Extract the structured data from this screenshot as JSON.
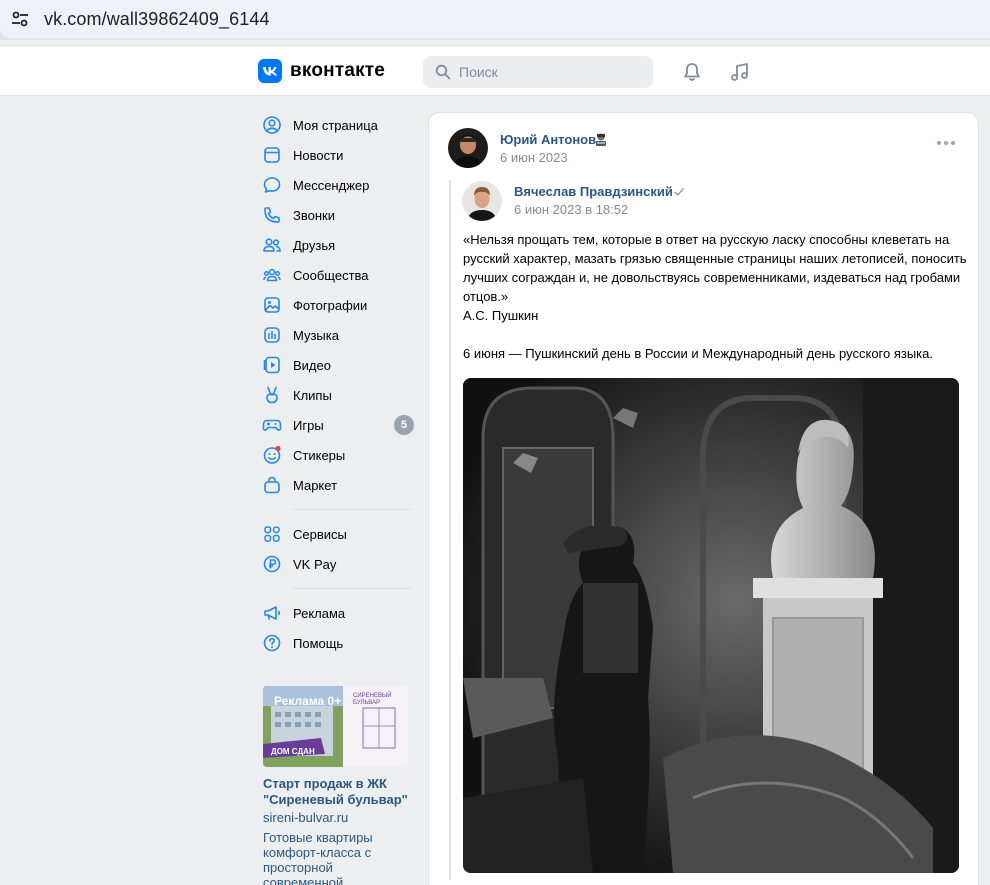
{
  "browser": {
    "url": "vk.com/wall39862409_6144"
  },
  "header": {
    "logo_text": "вконтакте",
    "logo_letter": "K",
    "search_placeholder": "Поиск",
    "brand_color": "#0077ff"
  },
  "nav": {
    "items": [
      {
        "label": "Моя страница",
        "icon": "profile-icon"
      },
      {
        "label": "Новости",
        "icon": "news-icon"
      },
      {
        "label": "Мессенджер",
        "icon": "messenger-icon"
      },
      {
        "label": "Звонки",
        "icon": "phone-icon"
      },
      {
        "label": "Друзья",
        "icon": "friends-icon"
      },
      {
        "label": "Сообщества",
        "icon": "communities-icon"
      },
      {
        "label": "Фотографии",
        "icon": "photos-icon"
      },
      {
        "label": "Музыка",
        "icon": "music-icon"
      },
      {
        "label": "Видео",
        "icon": "video-icon"
      },
      {
        "label": "Клипы",
        "icon": "clips-icon"
      },
      {
        "label": "Игры",
        "icon": "games-icon",
        "badge": "5"
      },
      {
        "label": "Стикеры",
        "icon": "stickers-icon"
      },
      {
        "label": "Маркет",
        "icon": "market-icon"
      }
    ],
    "extra": [
      {
        "label": "Сервисы",
        "icon": "services-icon"
      },
      {
        "label": "VK Pay",
        "icon": "vkpay-icon"
      }
    ],
    "bottom": [
      {
        "label": "Реклама",
        "icon": "ads-icon"
      },
      {
        "label": "Помощь",
        "icon": "help-icon"
      }
    ]
  },
  "ad": {
    "image_badge": "Реклама 0+",
    "image_label": "ДОМ СДАН",
    "image_brand": "СИРЕНЕВЫЙ БУЛЬВАР",
    "title": "Старт продаж в ЖК \"Сиреневый бульвар\"",
    "domain": "sireni-bulvar.ru",
    "description": "Готовые квартиры комфорт-класса с просторной современной"
  },
  "post": {
    "author": "Юрий Антонов",
    "date": "6 июн 2023",
    "repost": {
      "author": "Вячеслав Правдзинский",
      "date": "6 июн 2023 в 18:52",
      "text_quote": "«Нельзя прощать тем, которые в ответ на русскую ласку способны клеветать на русский характер, мазать грязью священные страницы наших летописей, поносить лучших сограждан и, не довольствуясь современниками, издеваться над гробами отцов.»",
      "text_signature": "А.С. Пушкин",
      "text_footer": "6 июня — Пушкинский день в России и Международный день русского языка."
    }
  },
  "colors": {
    "link": "#2a5885",
    "secondary_text": "#818c99",
    "icon": "#2688eb",
    "page_bg": "#edeef0"
  }
}
